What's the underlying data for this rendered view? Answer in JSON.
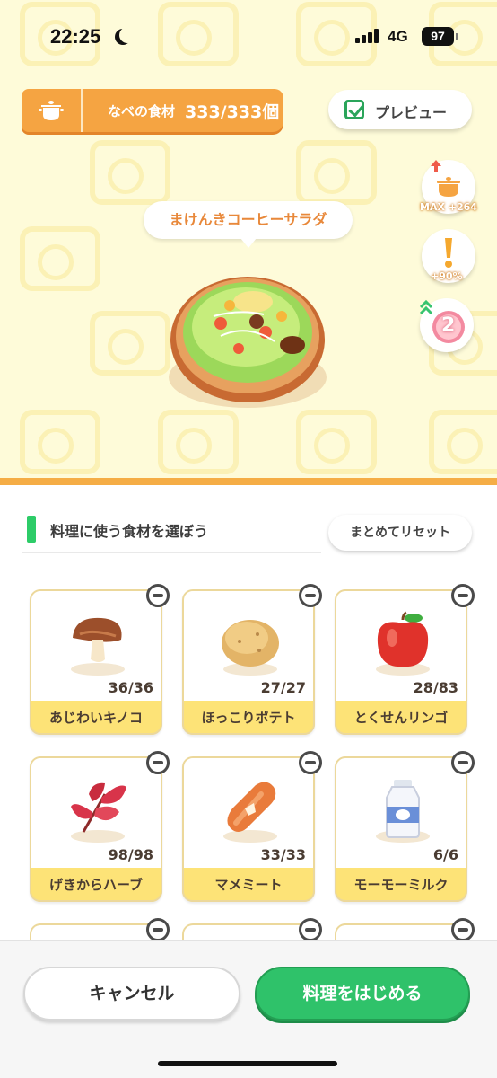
{
  "status_bar": {
    "time": "22:25",
    "network": "4G",
    "battery": "97"
  },
  "pot": {
    "label": "なべの食材",
    "count": "333/333個"
  },
  "preview": {
    "label": "プレビュー",
    "checked": true
  },
  "side_badges": {
    "pot_capacity": "MAX +264",
    "success_rate": "+90%",
    "level": "2"
  },
  "dish": {
    "name": "まけんきコーヒーサラダ"
  },
  "ingredients_section": {
    "title": "料理に使う食材を選ぼう",
    "reset_label": "まとめてリセット"
  },
  "ingredients": [
    {
      "name": "あじわいキノコ",
      "count": "36/36",
      "icon": "mushroom-icon"
    },
    {
      "name": "ほっこりポテト",
      "count": "27/27",
      "icon": "potato-icon"
    },
    {
      "name": "とくせんリンゴ",
      "count": "28/83",
      "icon": "apple-icon"
    },
    {
      "name": "げきからハーブ",
      "count": "98/98",
      "icon": "herb-icon"
    },
    {
      "name": "マメミート",
      "count": "33/33",
      "icon": "sausage-icon"
    },
    {
      "name": "モーモーミルク",
      "count": "6/6",
      "icon": "milk-bottle-icon"
    }
  ],
  "footer": {
    "cancel_label": "キャンセル",
    "cook_label": "料理をはじめる"
  },
  "colors": {
    "accent_orange": "#f5a442",
    "accent_green": "#2fc26a",
    "label_yellow": "#fde377",
    "dish_name": "#e8883a"
  }
}
